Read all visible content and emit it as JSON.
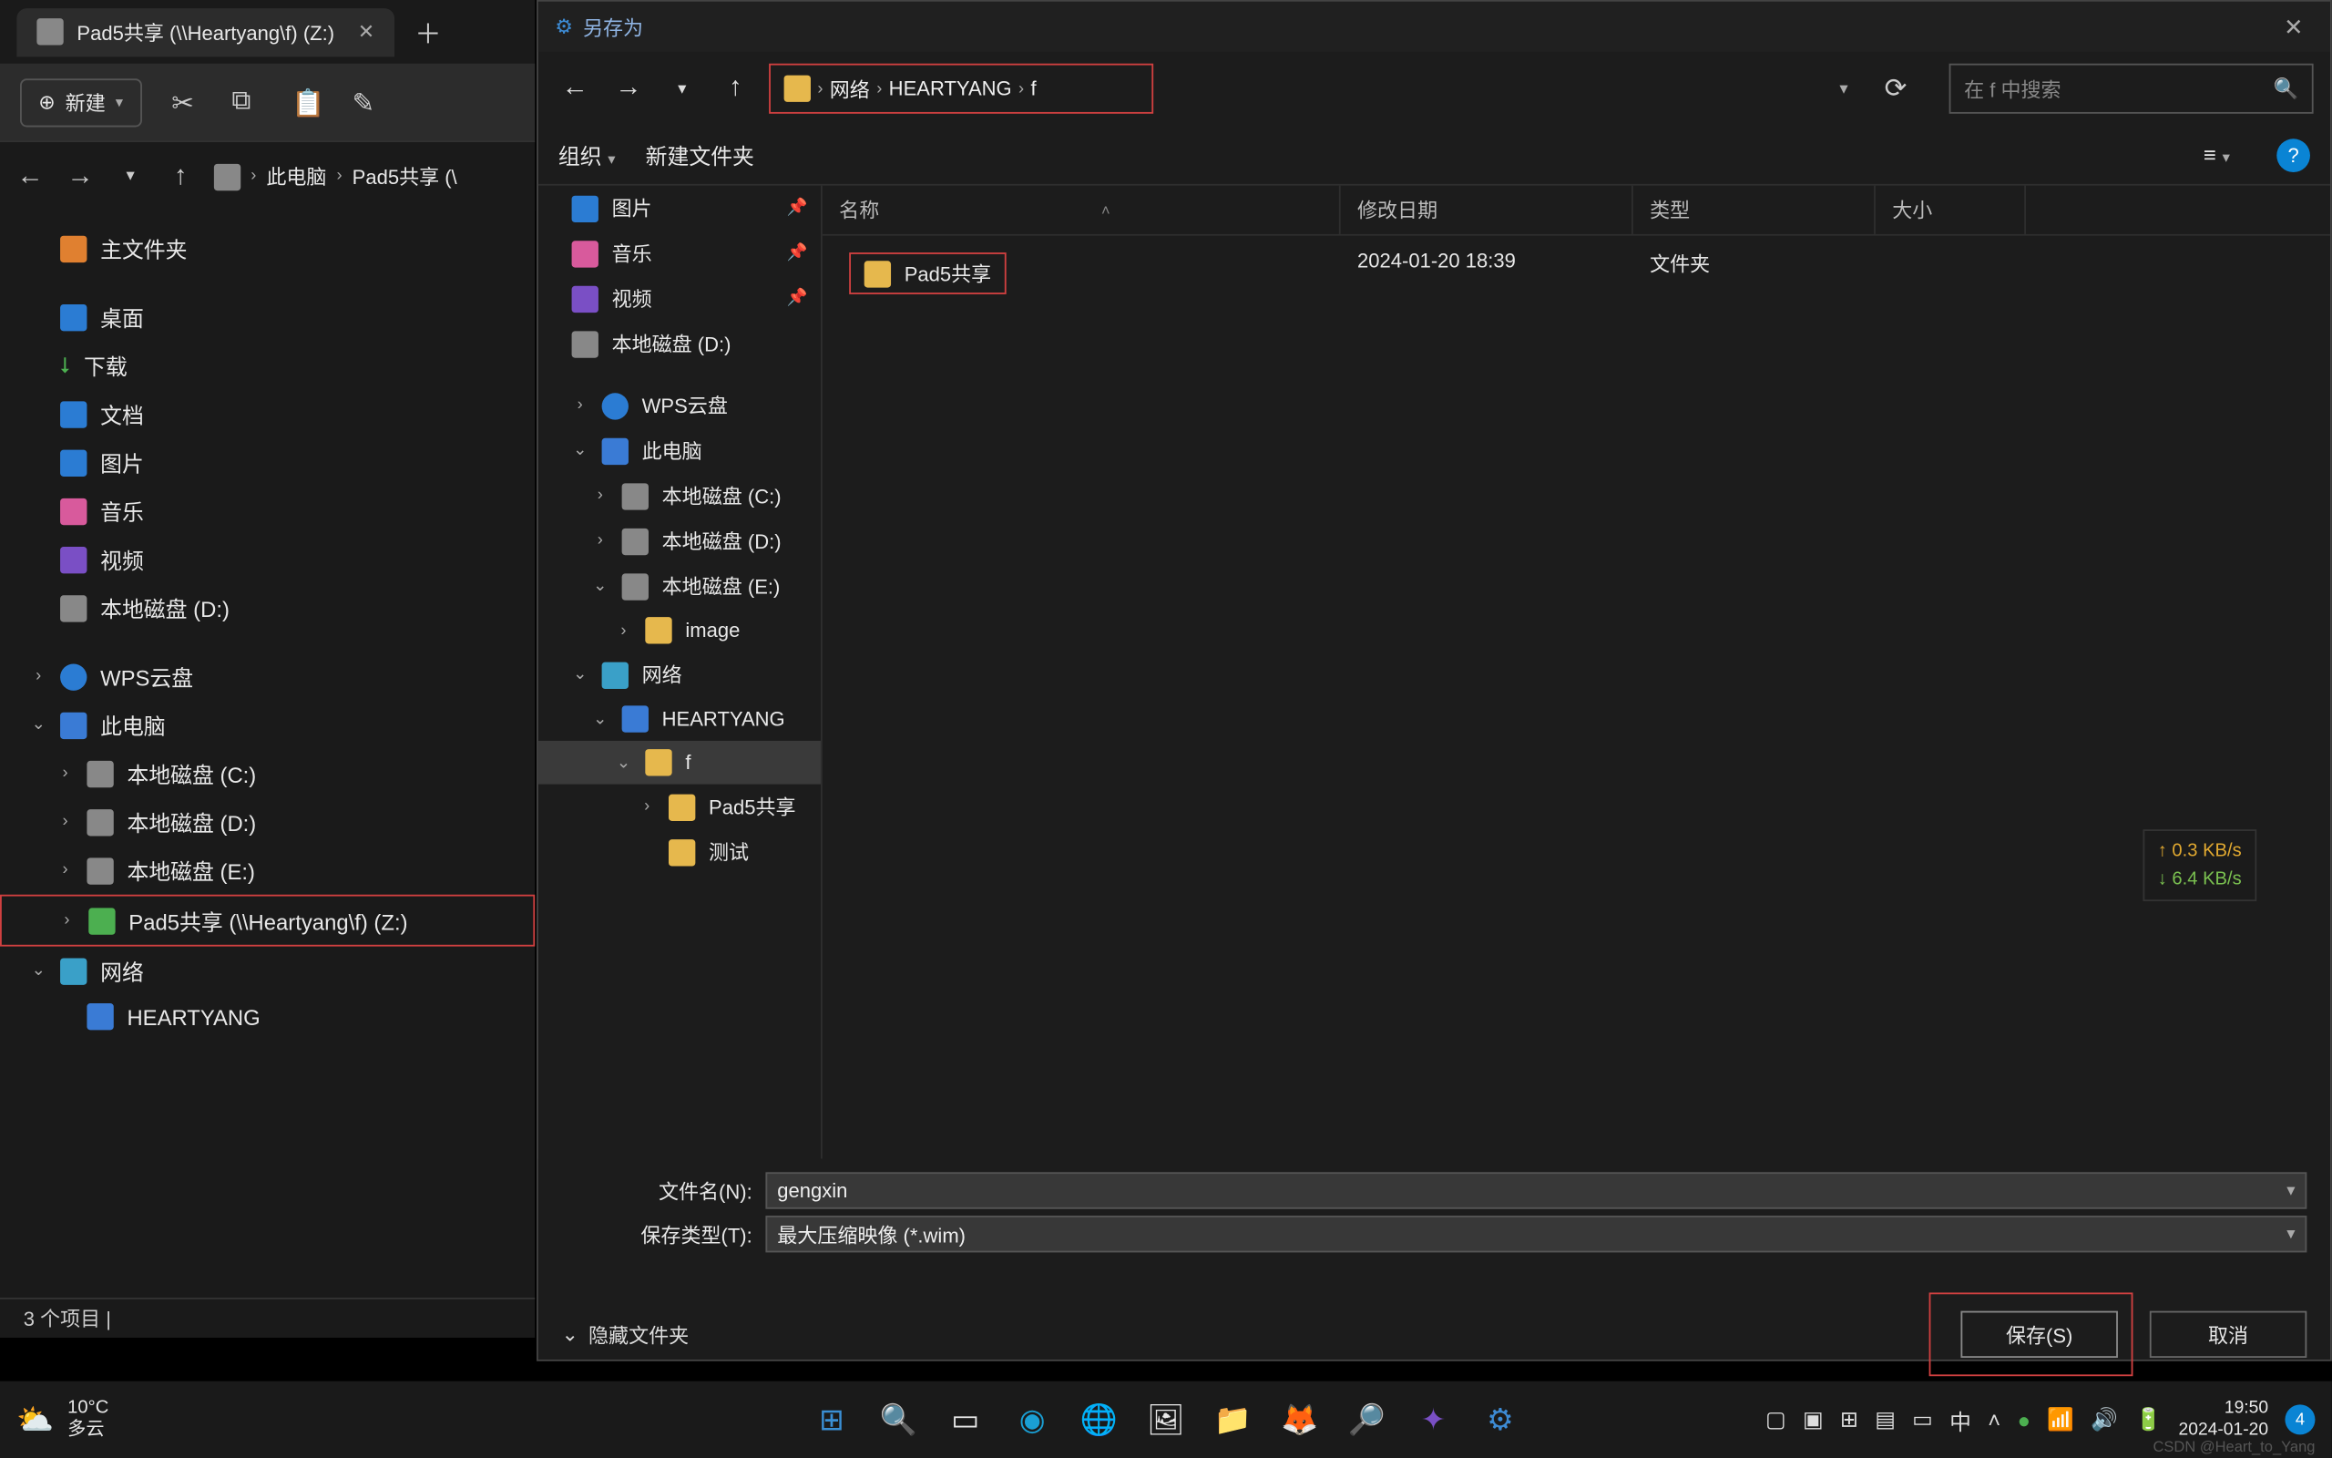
{
  "bg": {
    "tab_title": "Pad5共享 (\\\\Heartyang\\f) (Z:)",
    "new_button": "新建",
    "breadcrumb": {
      "seg1": "此电脑",
      "seg2": "Pad5共享 (\\"
    },
    "tree": {
      "home": "主文件夹",
      "desktop": "桌面",
      "downloads": "下载",
      "documents": "文档",
      "pictures": "图片",
      "music": "音乐",
      "videos": "视频",
      "disk_d": "本地磁盘 (D:)",
      "wps": "WPS云盘",
      "this_pc": "此电脑",
      "disk_c": "本地磁盘 (C:)",
      "disk_d2": "本地磁盘 (D:)",
      "disk_e": "本地磁盘 (E:)",
      "pad5": "Pad5共享 (\\\\Heartyang\\f) (Z:)",
      "network": "网络",
      "heartyang": "HEARTYANG"
    },
    "status": "3 个项目  |"
  },
  "dlg": {
    "title": "另存为",
    "path": {
      "seg1": "网络",
      "seg2": "HEARTYANG",
      "seg3": "f"
    },
    "search_placeholder": "在 f 中搜索",
    "toolbar": {
      "organize": "组织",
      "new_folder": "新建文件夹"
    },
    "columns": {
      "name": "名称",
      "date": "修改日期",
      "type": "类型",
      "size": "大小"
    },
    "tree": {
      "pictures": "图片",
      "music": "音乐",
      "videos": "视频",
      "disk_d": "本地磁盘 (D:)",
      "wps": "WPS云盘",
      "this_pc": "此电脑",
      "disk_c": "本地磁盘 (C:)",
      "disk_d2": "本地磁盘 (D:)",
      "disk_e": "本地磁盘 (E:)",
      "image": "image",
      "network": "网络",
      "heartyang": "HEARTYANG",
      "f": "f",
      "pad5": "Pad5共享",
      "test": "测试"
    },
    "row": {
      "name": "Pad5共享",
      "date": "2024-01-20 18:39",
      "type": "文件夹"
    },
    "filename_label": "文件名(N):",
    "filename_value": "gengxin",
    "filetype_label": "保存类型(T):",
    "filetype_value": "最大压缩映像 (*.wim)",
    "hide_folders": "隐藏文件夹",
    "save_btn": "保存(S)",
    "cancel_btn": "取消"
  },
  "net": {
    "up": "↑ 0.3 KB/s",
    "down": "↓ 6.4 KB/s"
  },
  "taskbar": {
    "temp": "10°C",
    "weather": "多云",
    "ime": "中",
    "time": "19:50",
    "date": "2024-01-20",
    "notif_count": "4"
  },
  "watermark": "CSDN @Heart_to_Yang"
}
